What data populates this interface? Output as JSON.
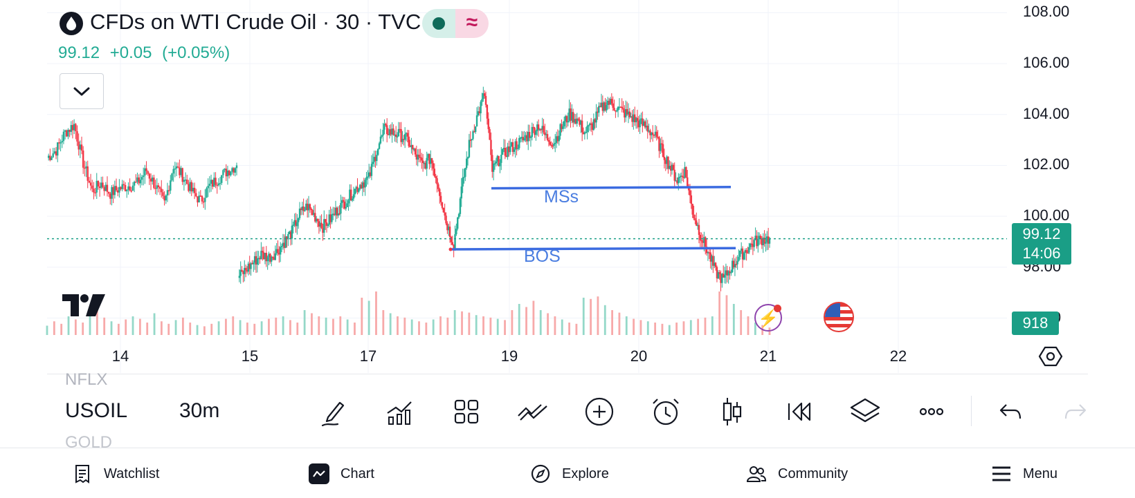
{
  "header": {
    "title": "CFDs on WTI Crude Oil · 30 · TVC",
    "wave_glyph": "≈",
    "price": "99.12",
    "change": "+0.05",
    "change_pct": "(+0.05%)",
    "icon_logo": "oil-drop-icon",
    "icon_collapse": "chevron-down-icon"
  },
  "colors": {
    "up": "#22ab94",
    "down": "#f23645",
    "drawing": "#3b6be0",
    "price_line": "#1a9e86",
    "badge_bg": "#1a9e86"
  },
  "y_axis": {
    "labels": [
      "108.00",
      "106.00",
      "104.00",
      "102.00",
      "100.00",
      "98.00",
      "96.00"
    ]
  },
  "x_axis": {
    "labels": [
      "14",
      "15",
      "17",
      "19",
      "20",
      "21",
      "22"
    ]
  },
  "price_tag": {
    "price": "99.12",
    "countdown": "14:06"
  },
  "volume_tag": "918",
  "drawings": [
    {
      "label": "MSs",
      "y_start": 101.1,
      "y_end": 101.15
    },
    {
      "label": "BOS",
      "y_start": 98.7,
      "y_end": 98.75
    }
  ],
  "chart_data": {
    "type": "candlestick",
    "ylim": [
      95.2,
      108.5
    ],
    "last_price": 99.12,
    "series": [
      {
        "name": "close",
        "segment": "day-14",
        "values": [
          102.3,
          102.6,
          103.3,
          103.6,
          102.1,
          101.0,
          101.3,
          100.9,
          101.1,
          101.2,
          101.3,
          101.8,
          101.2,
          100.5,
          102.0,
          101.6,
          101.0,
          100.6,
          101.2,
          101.5,
          101.8,
          102.0
        ]
      },
      {
        "name": "close",
        "segment": "day-15-to-21",
        "values": [
          97.6,
          97.9,
          98.2,
          98.5,
          98.4,
          98.6,
          99.0,
          99.4,
          100.1,
          100.4,
          100.0,
          99.6,
          99.9,
          100.3,
          100.6,
          101.0,
          101.3,
          101.5,
          102.6,
          103.4,
          103.3,
          103.2,
          103.0,
          102.4,
          102.0,
          102.3,
          101.2,
          99.8,
          98.9,
          101.0,
          102.8,
          103.9,
          104.8,
          101.8,
          102.3,
          102.6,
          102.8,
          103.0,
          103.3,
          103.6,
          103.1,
          102.9,
          103.5,
          104.0,
          103.8,
          103.3,
          103.6,
          104.2,
          104.5,
          104.3,
          104.1,
          103.9,
          103.7,
          103.5,
          103.2,
          102.6,
          102.0,
          101.4,
          101.8,
          100.2,
          99.3,
          98.6,
          97.8,
          97.5,
          98.0,
          98.4,
          98.7,
          99.0,
          99.1,
          99.12
        ]
      }
    ],
    "volume": [
      15,
      22,
      18,
      30,
      25,
      20,
      34,
      40,
      28,
      22,
      18,
      25,
      30,
      26,
      20,
      35,
      22,
      18,
      24,
      28,
      20,
      16,
      14,
      18,
      22,
      26,
      30,
      24,
      20,
      18,
      22,
      26,
      28,
      30,
      24,
      20,
      40,
      35,
      30,
      28,
      26,
      30,
      25,
      20,
      60,
      55,
      70,
      40,
      35,
      30,
      28,
      25,
      22,
      20,
      25,
      30,
      28,
      40,
      38,
      36,
      32,
      30,
      28,
      26,
      24,
      40,
      50,
      45,
      55,
      40,
      35,
      30,
      25,
      20,
      18,
      60,
      58,
      62,
      48,
      40,
      36,
      30,
      26,
      24,
      22,
      20,
      18,
      16,
      20,
      22,
      24,
      26,
      28,
      30,
      70,
      64,
      50,
      40,
      30,
      20,
      16,
      12
    ]
  },
  "bottom_toolbar": {
    "symbol_prev": "NFLX",
    "symbol_current": "USOIL",
    "symbol_next": "GOLD",
    "interval": "30m",
    "tools": [
      "pencil-icon",
      "indicators-icon",
      "grid-layout-icon",
      "trend-lines-icon",
      "add-icon",
      "alarm-icon",
      "candles-icon",
      "replay-icon",
      "layers-icon",
      "more-icon",
      "undo-icon",
      "redo-icon"
    ]
  },
  "tabs": [
    {
      "label": "Watchlist",
      "icon": "watchlist-icon"
    },
    {
      "label": "Chart",
      "icon": "chart-icon"
    },
    {
      "label": "Explore",
      "icon": "compass-icon"
    },
    {
      "label": "Community",
      "icon": "community-icon"
    },
    {
      "label": "Menu",
      "icon": "menu-icon"
    }
  ]
}
